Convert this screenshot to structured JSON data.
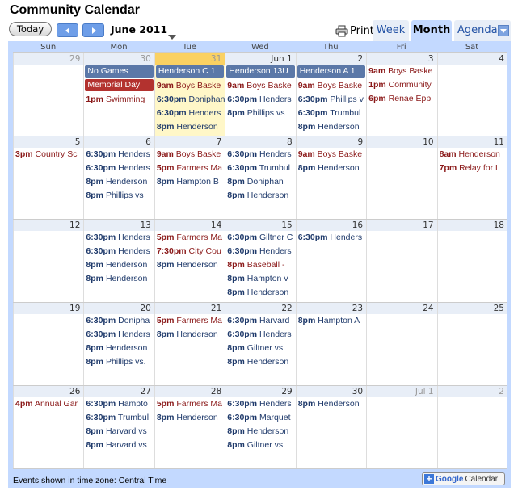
{
  "header": {
    "title": "Community Calendar",
    "today_label": "Today",
    "month_label": "June 2011",
    "print_label": "Print",
    "tabs": [
      {
        "label": "Week"
      },
      {
        "label": "Month"
      },
      {
        "label": "Agenda"
      }
    ],
    "icons": [
      "chevron-left-icon",
      "chevron-right-icon",
      "dropdown-arrow-icon",
      "printer-icon"
    ]
  },
  "day_headers": [
    "Sun",
    "Mon",
    "Tue",
    "Wed",
    "Thu",
    "Fri",
    "Sat"
  ],
  "weeks": [
    [
      {
        "num": "29",
        "other": true,
        "events": []
      },
      {
        "num": "30",
        "other": true,
        "allday": [
          {
            "text": "No Games",
            "color": "blue"
          },
          {
            "text": "Memorial Day",
            "color": "red"
          }
        ],
        "events": [
          {
            "time": "1pm",
            "text": "Swimming",
            "color": "red"
          }
        ]
      },
      {
        "num": "31",
        "other": true,
        "today": true,
        "allday": [
          {
            "text": "Henderson C 1",
            "color": "blue"
          }
        ],
        "events": [
          {
            "time": "9am",
            "text": "Boys Baske",
            "color": "red"
          },
          {
            "time": "6:30pm",
            "text": "Doniphan",
            "color": "blue"
          },
          {
            "time": "6:30pm",
            "text": "Henders",
            "color": "blue"
          },
          {
            "time": "8pm",
            "text": "Henderson",
            "color": "blue"
          }
        ]
      },
      {
        "num": "Jun 1",
        "allday": [
          {
            "text": "Henderson 13U",
            "color": "blue"
          }
        ],
        "events": [
          {
            "time": "9am",
            "text": "Boys Baske",
            "color": "red"
          },
          {
            "time": "6:30pm",
            "text": "Henders",
            "color": "blue"
          },
          {
            "time": "8pm",
            "text": "Phillips vs",
            "color": "blue"
          }
        ]
      },
      {
        "num": "2",
        "allday": [
          {
            "text": "Henderson A 1",
            "color": "blue"
          }
        ],
        "events": [
          {
            "time": "9am",
            "text": "Boys Baske",
            "color": "red"
          },
          {
            "time": "6:30pm",
            "text": "Phillips v",
            "color": "blue"
          },
          {
            "time": "6:30pm",
            "text": "Trumbul",
            "color": "blue"
          },
          {
            "time": "8pm",
            "text": "Henderson",
            "color": "blue"
          }
        ]
      },
      {
        "num": "3",
        "events": [
          {
            "time": "9am",
            "text": "Boys Baske",
            "color": "red"
          },
          {
            "time": "1pm",
            "text": "Community",
            "color": "red"
          },
          {
            "time": "6pm",
            "text": "Renae Epp",
            "color": "red"
          }
        ]
      },
      {
        "num": "4",
        "events": []
      }
    ],
    [
      {
        "num": "5",
        "events": [
          {
            "time": "3pm",
            "text": "Country Sc",
            "color": "red"
          }
        ]
      },
      {
        "num": "6",
        "events": [
          {
            "time": "6:30pm",
            "text": "Henders",
            "color": "blue"
          },
          {
            "time": "6:30pm",
            "text": "Henders",
            "color": "blue"
          },
          {
            "time": "8pm",
            "text": "Henderson",
            "color": "blue"
          },
          {
            "time": "8pm",
            "text": "Phillips vs",
            "color": "blue"
          }
        ]
      },
      {
        "num": "7",
        "events": [
          {
            "time": "9am",
            "text": "Boys Baske",
            "color": "red"
          },
          {
            "time": "5pm",
            "text": "Farmers Ma",
            "color": "red"
          },
          {
            "time": "8pm",
            "text": "Hampton B",
            "color": "blue"
          }
        ]
      },
      {
        "num": "8",
        "events": [
          {
            "time": "6:30pm",
            "text": "Henders",
            "color": "blue"
          },
          {
            "time": "6:30pm",
            "text": "Trumbul",
            "color": "blue"
          },
          {
            "time": "8pm",
            "text": "Doniphan",
            "color": "blue"
          },
          {
            "time": "8pm",
            "text": "Henderson",
            "color": "blue"
          }
        ]
      },
      {
        "num": "9",
        "events": [
          {
            "time": "9am",
            "text": "Boys Baske",
            "color": "red"
          },
          {
            "time": "8pm",
            "text": "Henderson",
            "color": "blue"
          }
        ]
      },
      {
        "num": "10",
        "events": []
      },
      {
        "num": "11",
        "events": [
          {
            "time": "8am",
            "text": "Henderson",
            "color": "red"
          },
          {
            "time": "7pm",
            "text": "Relay for L",
            "color": "red"
          }
        ]
      }
    ],
    [
      {
        "num": "12",
        "events": []
      },
      {
        "num": "13",
        "events": [
          {
            "time": "6:30pm",
            "text": "Henders",
            "color": "blue"
          },
          {
            "time": "6:30pm",
            "text": "Henders",
            "color": "blue"
          },
          {
            "time": "8pm",
            "text": "Henderson",
            "color": "blue"
          },
          {
            "time": "8pm",
            "text": "Henderson",
            "color": "blue"
          }
        ]
      },
      {
        "num": "14",
        "events": [
          {
            "time": "5pm",
            "text": "Farmers Ma",
            "color": "red"
          },
          {
            "time": "7:30pm",
            "text": "City Cou",
            "color": "red"
          },
          {
            "time": "8pm",
            "text": "Henderson",
            "color": "blue"
          }
        ]
      },
      {
        "num": "15",
        "events": [
          {
            "time": "6:30pm",
            "text": "Giltner C",
            "color": "blue"
          },
          {
            "time": "6:30pm",
            "text": "Henders",
            "color": "blue"
          },
          {
            "time": "8pm",
            "text": "Baseball -",
            "color": "red"
          },
          {
            "time": "8pm",
            "text": "Hampton v",
            "color": "blue"
          },
          {
            "time": "8pm",
            "text": "Henderson",
            "color": "blue"
          }
        ]
      },
      {
        "num": "16",
        "events": [
          {
            "time": "6:30pm",
            "text": "Henders",
            "color": "blue"
          }
        ]
      },
      {
        "num": "17",
        "events": []
      },
      {
        "num": "18",
        "events": []
      }
    ],
    [
      {
        "num": "19",
        "events": []
      },
      {
        "num": "20",
        "events": [
          {
            "time": "6:30pm",
            "text": "Donipha",
            "color": "blue"
          },
          {
            "time": "6:30pm",
            "text": "Henders",
            "color": "blue"
          },
          {
            "time": "8pm",
            "text": "Henderson",
            "color": "blue"
          },
          {
            "time": "8pm",
            "text": "Phillips vs.",
            "color": "blue"
          }
        ]
      },
      {
        "num": "21",
        "events": [
          {
            "time": "5pm",
            "text": "Farmers Ma",
            "color": "red"
          },
          {
            "time": "8pm",
            "text": "Henderson",
            "color": "blue"
          }
        ]
      },
      {
        "num": "22",
        "events": [
          {
            "time": "6:30pm",
            "text": "Harvard",
            "color": "blue"
          },
          {
            "time": "6:30pm",
            "text": "Henders",
            "color": "blue"
          },
          {
            "time": "8pm",
            "text": "Giltner vs.",
            "color": "blue"
          },
          {
            "time": "8pm",
            "text": "Henderson",
            "color": "blue"
          }
        ]
      },
      {
        "num": "23",
        "events": [
          {
            "time": "8pm",
            "text": "Hampton A",
            "color": "blue"
          }
        ]
      },
      {
        "num": "24",
        "events": []
      },
      {
        "num": "25",
        "events": []
      }
    ],
    [
      {
        "num": "26",
        "events": [
          {
            "time": "4pm",
            "text": "Annual Gar",
            "color": "red"
          }
        ]
      },
      {
        "num": "27",
        "events": [
          {
            "time": "6:30pm",
            "text": "Hampto",
            "color": "blue"
          },
          {
            "time": "6:30pm",
            "text": "Trumbul",
            "color": "blue"
          },
          {
            "time": "8pm",
            "text": "Harvard vs",
            "color": "blue"
          },
          {
            "time": "8pm",
            "text": "Harvard vs",
            "color": "blue"
          }
        ]
      },
      {
        "num": "28",
        "events": [
          {
            "time": "5pm",
            "text": "Farmers Ma",
            "color": "red"
          },
          {
            "time": "8pm",
            "text": "Henderson",
            "color": "blue"
          }
        ]
      },
      {
        "num": "29",
        "events": [
          {
            "time": "6:30pm",
            "text": "Henders",
            "color": "blue"
          },
          {
            "time": "6:30pm",
            "text": "Marquet",
            "color": "blue"
          },
          {
            "time": "8pm",
            "text": "Henderson",
            "color": "blue"
          },
          {
            "time": "8pm",
            "text": "Giltner vs.",
            "color": "blue"
          }
        ]
      },
      {
        "num": "30",
        "events": [
          {
            "time": "8pm",
            "text": "Henderson",
            "color": "blue"
          }
        ]
      },
      {
        "num": "Jul 1",
        "other": true,
        "events": []
      },
      {
        "num": "2",
        "other": true,
        "events": []
      }
    ]
  ],
  "footer": {
    "timezone": "Events shown in time zone: Central Time",
    "badge_brand": "Google",
    "badge_label": "Calendar"
  },
  "colors": {
    "frame": "#c3d9ff",
    "today": "#fad163",
    "event_blue": "#1f3a6b",
    "event_red": "#8b1a1a",
    "allday_blue": "#5b78a8",
    "allday_red": "#b3322f"
  }
}
